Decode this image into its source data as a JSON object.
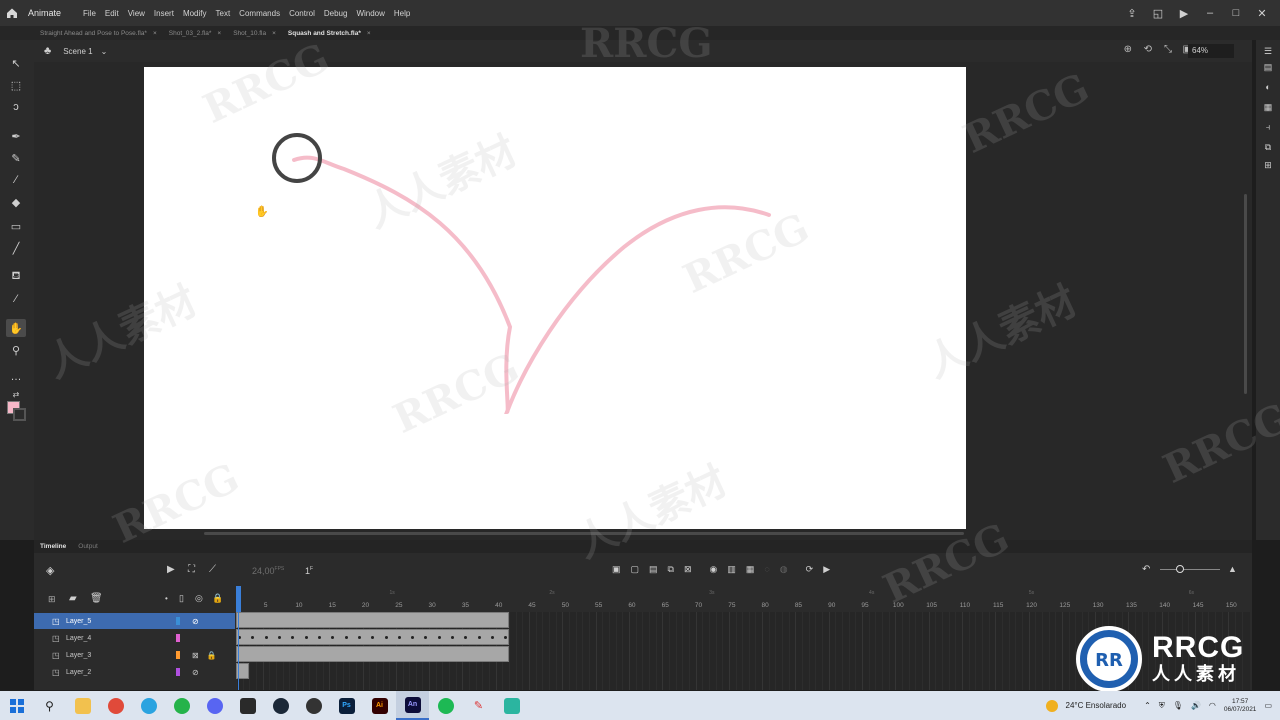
{
  "app": {
    "name": "Animate",
    "menus": [
      "File",
      "Edit",
      "View",
      "Insert",
      "Modify",
      "Text",
      "Commands",
      "Control",
      "Debug",
      "Window",
      "Help"
    ]
  },
  "tabs": [
    {
      "label": "Straight Ahead and Pose to Pose.fla*",
      "active": false
    },
    {
      "label": "Shot_03_2.fla*",
      "active": false
    },
    {
      "label": "Shot_10.fla",
      "active": false
    },
    {
      "label": "Squash and Stretch.fla*",
      "active": true
    }
  ],
  "tab_close": "×",
  "scene": {
    "label": "Scene 1",
    "zoom": "64%"
  },
  "timeline": {
    "tabs": [
      "Timeline",
      "Output"
    ],
    "fps": "24,00",
    "fps_unit": "FPS",
    "current_frame": "1",
    "frame_unit": "F",
    "ruler_frames": [
      5,
      10,
      15,
      20,
      25,
      30,
      35,
      40,
      45,
      50,
      55,
      60,
      65,
      70,
      75,
      80,
      85,
      90,
      95,
      100,
      105,
      110,
      115,
      120,
      125,
      130,
      135,
      140,
      145,
      150
    ],
    "ruler_seconds": [
      "1s",
      "2s",
      "3s",
      "4s",
      "5s",
      "6s"
    ],
    "layers": [
      {
        "name": "Layer_5",
        "color": "#3a8fd6",
        "selected": true,
        "hidden": true,
        "locked": false
      },
      {
        "name": "Layer_4",
        "color": "#e060d0",
        "selected": false,
        "hidden": false,
        "locked": false
      },
      {
        "name": "Layer_3",
        "color": "#ff9a30",
        "selected": false,
        "hidden": false,
        "locked": true
      },
      {
        "name": "Layer_2",
        "color": "#b050e0",
        "selected": false,
        "hidden": true,
        "locked": false
      }
    ]
  },
  "colors": {
    "stroke": "#444444",
    "fill": "#f6b8c8",
    "arc": "#f4b5c3"
  },
  "taskbar": {
    "apps": [
      "windows-start",
      "search",
      "file-explorer",
      "chrome",
      "telegram",
      "whatsapp",
      "discord",
      "epic-games",
      "steam",
      "app-clip",
      "photoshop",
      "illustrator",
      "animate",
      "spotify",
      "app-pin",
      "app-green"
    ],
    "app_labels": {
      "photoshop": "Ps",
      "illustrator": "Ai",
      "animate": "An"
    },
    "weather": "24°C  Ensolarado",
    "time": "17:57",
    "date": "06/07/2021"
  },
  "watermark": {
    "brand": "RRCG",
    "cn": "人人素材"
  }
}
